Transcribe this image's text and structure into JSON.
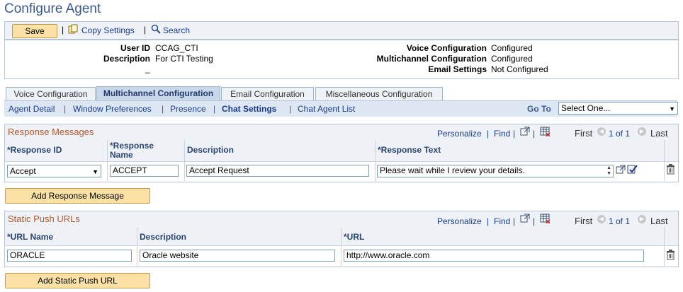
{
  "page": {
    "title": "Configure Agent"
  },
  "toolbar": {
    "save_label": "Save",
    "sep": "|",
    "copy_label": "Copy Settings",
    "search_label": "Search"
  },
  "info": {
    "user_id_label": "User ID",
    "user_id_value": "CCAG_CTI",
    "description_label": "Description",
    "description_value": "For CTI Testing",
    "underscore": "_",
    "voice_label": "Voice Configuration",
    "voice_value": "Configured",
    "multichannel_label": "Multichannel Configuration",
    "multichannel_value": "Configured",
    "email_label": "Email Settings",
    "email_value": "Not Configured"
  },
  "tabs": [
    {
      "label": "Voice Configuration"
    },
    {
      "label": "Multichannel Configuration"
    },
    {
      "label": "Email Configuration"
    },
    {
      "label": "Miscellaneous Configuration"
    }
  ],
  "subnav": {
    "links": [
      {
        "label": "Agent Detail"
      },
      {
        "label": "Window Preferences"
      },
      {
        "label": "Presence"
      },
      {
        "label": "Chat Settings"
      },
      {
        "label": "Chat Agent List"
      }
    ],
    "sep": "|",
    "goto_label": "Go To",
    "goto_value": "Select One..."
  },
  "response_grid": {
    "title": "Response Messages",
    "personalize": "Personalize",
    "pipe": "|",
    "find": "Find",
    "first": "First",
    "range": "1 of 1",
    "last": "Last",
    "headers": {
      "response_id": "*Response ID",
      "response_name": "*Response Name",
      "description": "Description",
      "response_text": "*Response Text"
    },
    "row": {
      "response_id": "Accept",
      "response_name": "ACCEPT",
      "description": "Accept Request",
      "response_text": "Please wait while I review your details."
    },
    "add_label": "Add Response Message"
  },
  "url_grid": {
    "title": "Static Push URLs",
    "personalize": "Personalize",
    "pipe": "|",
    "find": "Find",
    "first": "First",
    "range": "1 of 1",
    "last": "Last",
    "headers": {
      "url_name": "*URL Name",
      "description": "Description",
      "url": "*URL"
    },
    "row": {
      "url_name": "ORACLE",
      "description": "Oracle website",
      "url": "http://www.oracle.com"
    },
    "add_label": "Add Static Push URL"
  },
  "icons": {
    "copy": "copy-settings-icon",
    "search": "search-icon",
    "zoom": "view-all-icon",
    "download": "download-grid-icon",
    "delete": "delete-row-icon",
    "spellcheck": "spell-check-icon"
  },
  "colors": {
    "title": "#3a5a8c",
    "grid_title": "#b2582a",
    "link": "#1a3a8c",
    "button": "#fbe1a6",
    "tab_active": "#c9d7ea",
    "subnav_bg": "#dde7f3"
  }
}
